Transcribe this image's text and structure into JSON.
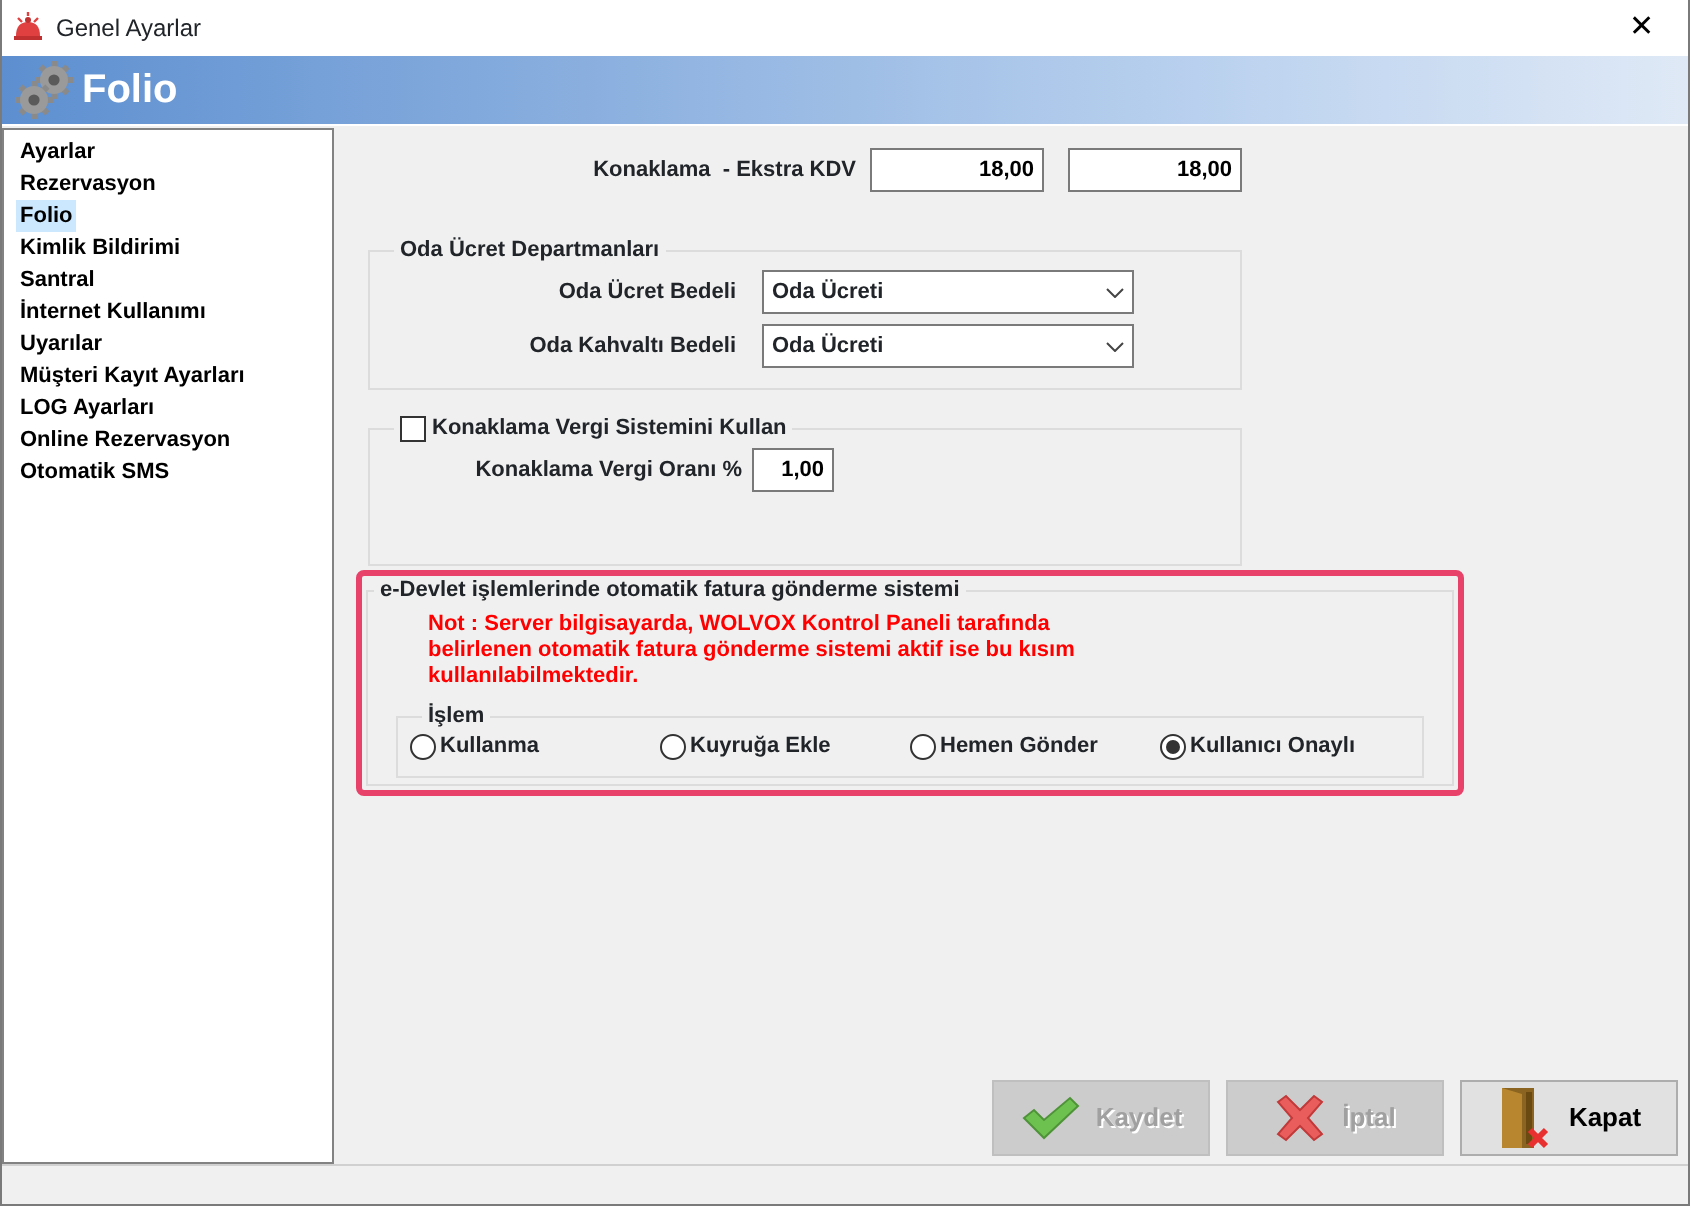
{
  "window": {
    "title": "Genel Ayarlar",
    "close": "✕"
  },
  "header": {
    "title": "Folio"
  },
  "sidebar": {
    "items": [
      {
        "label": "Ayarlar",
        "selected": false
      },
      {
        "label": "Rezervasyon",
        "selected": false
      },
      {
        "label": "Folio",
        "selected": true
      },
      {
        "label": "Kimlik Bildirimi",
        "selected": false
      },
      {
        "label": "Santral",
        "selected": false
      },
      {
        "label": "İnternet Kullanımı",
        "selected": false
      },
      {
        "label": "Uyarılar",
        "selected": false
      },
      {
        "label": "Müşteri Kayıt Ayarları",
        "selected": false
      },
      {
        "label": "LOG Ayarları",
        "selected": false
      },
      {
        "label": "Online Rezervasyon",
        "selected": false
      },
      {
        "label": "Otomatik SMS",
        "selected": false
      }
    ]
  },
  "kdv": {
    "label": "Konaklama  - Ekstra KDV",
    "values": [
      "18,00",
      "18,00"
    ]
  },
  "departments": {
    "title": "Oda Ücret Departmanları",
    "fields": [
      {
        "label": "Oda Ücret Bedeli",
        "value": "Oda Ücreti"
      },
      {
        "label": "Oda Kahvaltı Bedeli",
        "value": "Oda Ücreti"
      }
    ]
  },
  "tax": {
    "label": "Konaklama Vergi Sistemini Kullan",
    "checked": false,
    "rate_label": "Konaklama Vergi Oranı %",
    "rate": "1,00"
  },
  "edevlet": {
    "title": "e-Devlet işlemlerinde otomatik fatura gönderme sistemi",
    "highlighted": true,
    "note": "Not : Server bilgisayarda, WOLVOX Kontrol Paneli tarafında belirlenen otomatik fatura gönderme sistemi aktif ise bu kısım kullanılabilmektedir.",
    "group_title": "İşlem",
    "options": [
      {
        "label": "Kullanma",
        "selected": false
      },
      {
        "label": "Kuyruğa Ekle",
        "selected": false
      },
      {
        "label": "Hemen Gönder",
        "selected": false
      },
      {
        "label": "Kullanıcı Onaylı",
        "selected": true
      }
    ]
  },
  "buttons": [
    {
      "label": "Kaydet",
      "kind": "save",
      "disabled": true
    },
    {
      "label": "İptal",
      "kind": "cancel",
      "disabled": true
    },
    {
      "label": "Kapat",
      "kind": "close",
      "disabled": false
    }
  ]
}
